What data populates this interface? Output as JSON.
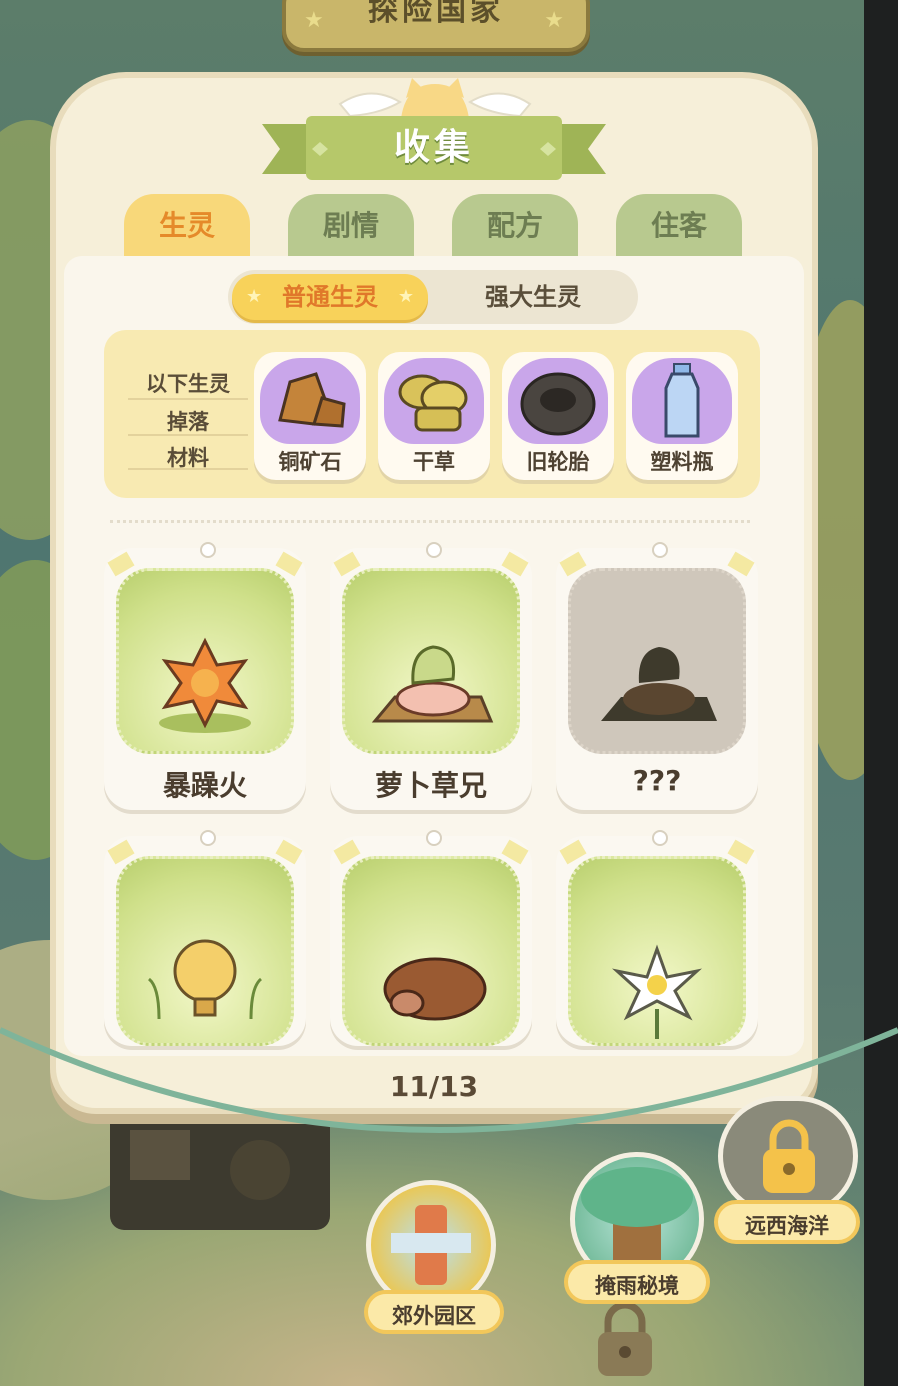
{
  "header": {
    "title": "探险国家"
  },
  "panel": {
    "title": "收集"
  },
  "tabs": [
    {
      "label": "生灵",
      "active": true
    },
    {
      "label": "剧情",
      "active": false
    },
    {
      "label": "配方",
      "active": false
    },
    {
      "label": "住客",
      "active": false
    }
  ],
  "segment": {
    "options": [
      "普通生灵",
      "强大生灵"
    ],
    "selected": "普通生灵"
  },
  "materials": {
    "label_lines": [
      "以下生灵",
      "掉落",
      "材料"
    ],
    "items": [
      {
        "name": "铜矿石",
        "icon": "copper-ore-icon"
      },
      {
        "name": "干草",
        "icon": "hay-icon"
      },
      {
        "name": "旧轮胎",
        "icon": "tire-icon"
      },
      {
        "name": "塑料瓶",
        "icon": "bottle-icon"
      }
    ]
  },
  "creatures": [
    {
      "name": "暴躁火",
      "icon": "fire-star-icon",
      "unlocked": true
    },
    {
      "name": "萝卜草兄",
      "icon": "radish-grass-icon",
      "unlocked": true
    },
    {
      "name": "???",
      "icon": "radish-silhouette-icon",
      "unlocked": false
    },
    {
      "name": "",
      "icon": "bulb-creature-icon",
      "unlocked": true
    },
    {
      "name": "",
      "icon": "yak-icon",
      "unlocked": true
    },
    {
      "name": "",
      "icon": "lily-flower-icon",
      "unlocked": true
    }
  ],
  "progress": {
    "text": "11/13",
    "collected": 11,
    "total": 13
  },
  "locations": [
    {
      "name": "郊外园区",
      "icon": "park-gate-icon"
    },
    {
      "name": "掩雨秘境",
      "icon": "tree-house-icon"
    },
    {
      "name": "远西海洋",
      "icon": "lock-icon"
    }
  ]
}
